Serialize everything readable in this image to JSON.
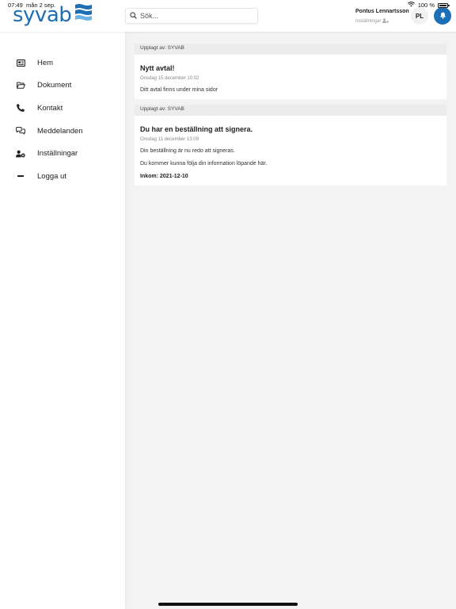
{
  "status_bar": {
    "time": "07:49",
    "date": "mån 2 sep.",
    "battery": "100 %"
  },
  "header": {
    "logo_text": "syvab",
    "search_placeholder": "Sök...",
    "user_name": "Pontus Lennartsson",
    "user_settings": "Inställningar",
    "avatar_initials": "PL",
    "accent_color": "#1d6fb5"
  },
  "sidebar": {
    "items": [
      {
        "label": "Hem",
        "icon": "home-card-icon"
      },
      {
        "label": "Dokument",
        "icon": "folder-open-icon"
      },
      {
        "label": "Kontakt",
        "icon": "phone-icon"
      },
      {
        "label": "Meddelanden",
        "icon": "chat-bubbles-icon"
      },
      {
        "label": "Inställningar",
        "icon": "user-cog-icon"
      },
      {
        "label": "Logga ut",
        "icon": "minus-icon"
      }
    ]
  },
  "feed": {
    "posts": [
      {
        "posted_by": "Upplagt av: SYVAB",
        "title": "Nytt avtal!",
        "date": "Onsdag 15 december 10:02",
        "body": "Ditt avtal finns under mina sidor"
      },
      {
        "posted_by": "Upplagt av: SYVAB",
        "title": "Du har en beställning att signera.",
        "date": "Onsdag 11 december 13:09",
        "body": "Din beställning är nu redo att signeras.",
        "body2": "Du kommer kunna följa din information löpande här.",
        "received": "Inkom: 2021-12-10"
      }
    ]
  }
}
